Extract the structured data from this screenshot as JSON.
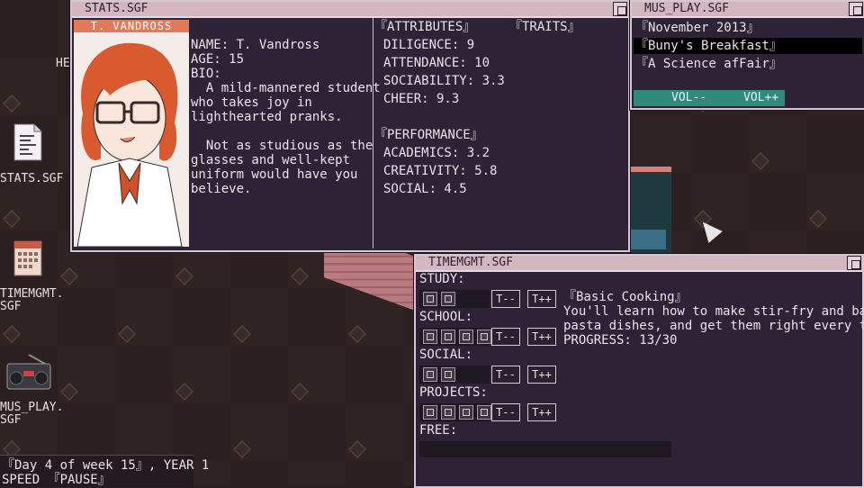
{
  "desktop": {
    "hidden_label": "HE",
    "icons": [
      {
        "label": "STATS.SGF",
        "icon": "document-icon"
      },
      {
        "label": "TIMEMGMT.\nSGF",
        "icon": "calendar-icon"
      },
      {
        "label": "MUS_PLAY.\nSGF",
        "icon": "radio-icon"
      }
    ]
  },
  "stats_window": {
    "title": "STATS.SGF",
    "portrait_name": "T. VANDROSS",
    "profile": {
      "name_line": "NAME: T. Vandross",
      "age_line": "AGE: 15",
      "bio_label": "BIO:",
      "bio_p1": "  A mild-mannered student\nwho takes joy in\nlighthearted pranks.",
      "bio_p2": "  Not as studious as the\nglasses and well-kept\nuniform would have you\nbelieve."
    },
    "attributes_header": "『ATTRIBUTES』",
    "traits_header": "『TRAITS』",
    "attributes": [
      "DILIGENCE: 9",
      "ATTENDANCE: 10",
      "SOCIABILITY: 3.3",
      "CHEER: 9.3"
    ],
    "performance_header": "『PERFORMANCE』",
    "performance": [
      "ACADEMICS: 3.2",
      "CREATIVITY: 5.8",
      "SOCIAL: 4.5"
    ]
  },
  "music_window": {
    "title": "MUS_PLAY.SGF",
    "tracks": [
      {
        "label": "『November 2013』",
        "selected": false
      },
      {
        "label": "『Buny's Breakfast』",
        "selected": true
      },
      {
        "label": "『A Science afFair』",
        "selected": false
      }
    ],
    "vol_down": "VOL--",
    "vol_up": "VOL++"
  },
  "time_window": {
    "title": "TIMEMGMT.SGF",
    "categories": [
      {
        "label": "STUDY:",
        "slots": 2
      },
      {
        "label": "SCHOOL:",
        "slots": 4
      },
      {
        "label": "SOCIAL:",
        "slots": 2
      },
      {
        "label": "PROJECTS:",
        "slots": 4
      }
    ],
    "free_label": "FREE:",
    "t_minus": "T--",
    "t_plus": "T++",
    "project": {
      "title": "『Basic Cooking』",
      "description": "You'll learn how to make stir-fry and basic\npasta dishes, and get them right every time.",
      "progress": "PROGRESS: 13/30"
    }
  },
  "status": {
    "day_line": "『Day 4 of week 15』, YEAR 1",
    "speed_line": "SPEED 『PAUSE』"
  }
}
